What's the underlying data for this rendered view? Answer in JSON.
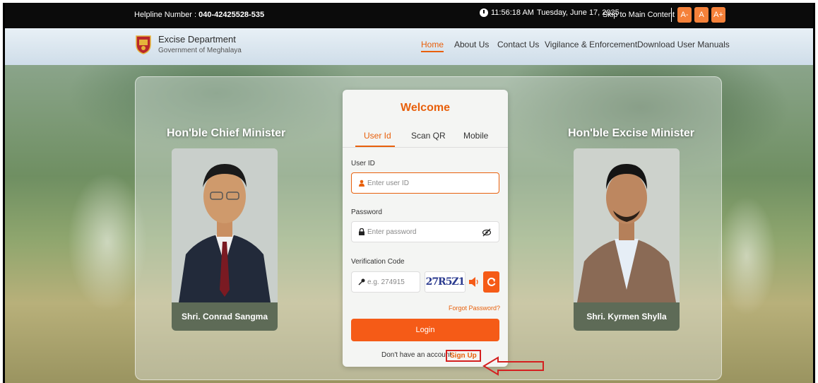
{
  "topbar": {
    "helpline_label": "Helpline Number : ",
    "helpline_number": "040-42425528-535",
    "time": "11:56:18 AM",
    "date": "Tuesday, June 17, 2025",
    "skip_link": "Skip to Main Content",
    "font_decrease": "A-",
    "font_normal": "A",
    "font_increase": "A+",
    "accent_color": "#f5813a"
  },
  "header": {
    "dept_name": "Excise Department",
    "dept_sub": "Government of Meghalaya",
    "nav": [
      "Home",
      "About Us",
      "Contact Us",
      "Vigilance & Enforcement",
      "Download User Manuals"
    ],
    "active_nav": "Home"
  },
  "left_minister": {
    "title": "Hon'ble Chief Minister",
    "name": "Shri. Conrad Sangma"
  },
  "right_minister": {
    "title": "Hon'ble Excise Minister",
    "name": "Shri. Kyrmen Shylla"
  },
  "login": {
    "welcome": "Welcome",
    "tabs": [
      "User Id",
      "Scan QR",
      "Mobile"
    ],
    "active_tab": "User Id",
    "userid_label": "User ID",
    "userid_placeholder": "Enter user ID",
    "password_label": "Password",
    "password_placeholder": "Enter password",
    "verification_label": "Verification Code",
    "verification_placeholder": "e.g. 274915",
    "captcha": "27R5Z1",
    "forgot": "Forgot Password?",
    "login_button": "Login",
    "no_account": "Don't have an account",
    "signup": "Sign Up",
    "brand_color": "#f55b17"
  }
}
